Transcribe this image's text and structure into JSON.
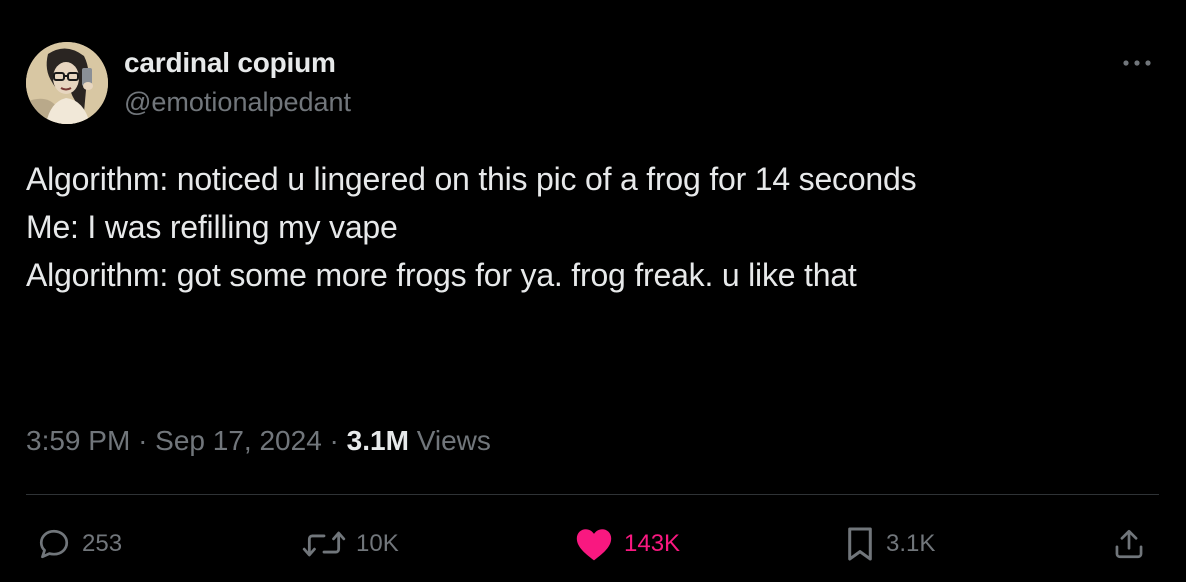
{
  "author": {
    "display_name": "cardinal copium",
    "handle": "@emotionalpedant"
  },
  "tweet": {
    "lines": [
      "Algorithm: noticed u lingered on this pic of a frog for 14 seconds",
      "",
      "Me: I was refilling my vape",
      "",
      "Algorithm: got some more frogs for ya. frog freak. u like that"
    ]
  },
  "meta": {
    "time": "3:59 PM",
    "separator": "·",
    "date": "Sep 17, 2024",
    "views_count": "3.1M",
    "views_label": "Views"
  },
  "actions": {
    "replies": "253",
    "reposts": "10K",
    "likes": "143K",
    "bookmarks": "3.1K"
  },
  "icons": {
    "more": "more-horizontal-icon",
    "reply": "reply-bubble-icon",
    "repost": "repost-arrows-icon",
    "like": "heart-filled-icon",
    "bookmark": "bookmark-icon",
    "share": "share-upload-icon"
  },
  "colors": {
    "background": "#000000",
    "text_primary": "#e7e9ea",
    "text_secondary": "#71767b",
    "divider": "#2f3336",
    "like_active": "#f91880"
  }
}
